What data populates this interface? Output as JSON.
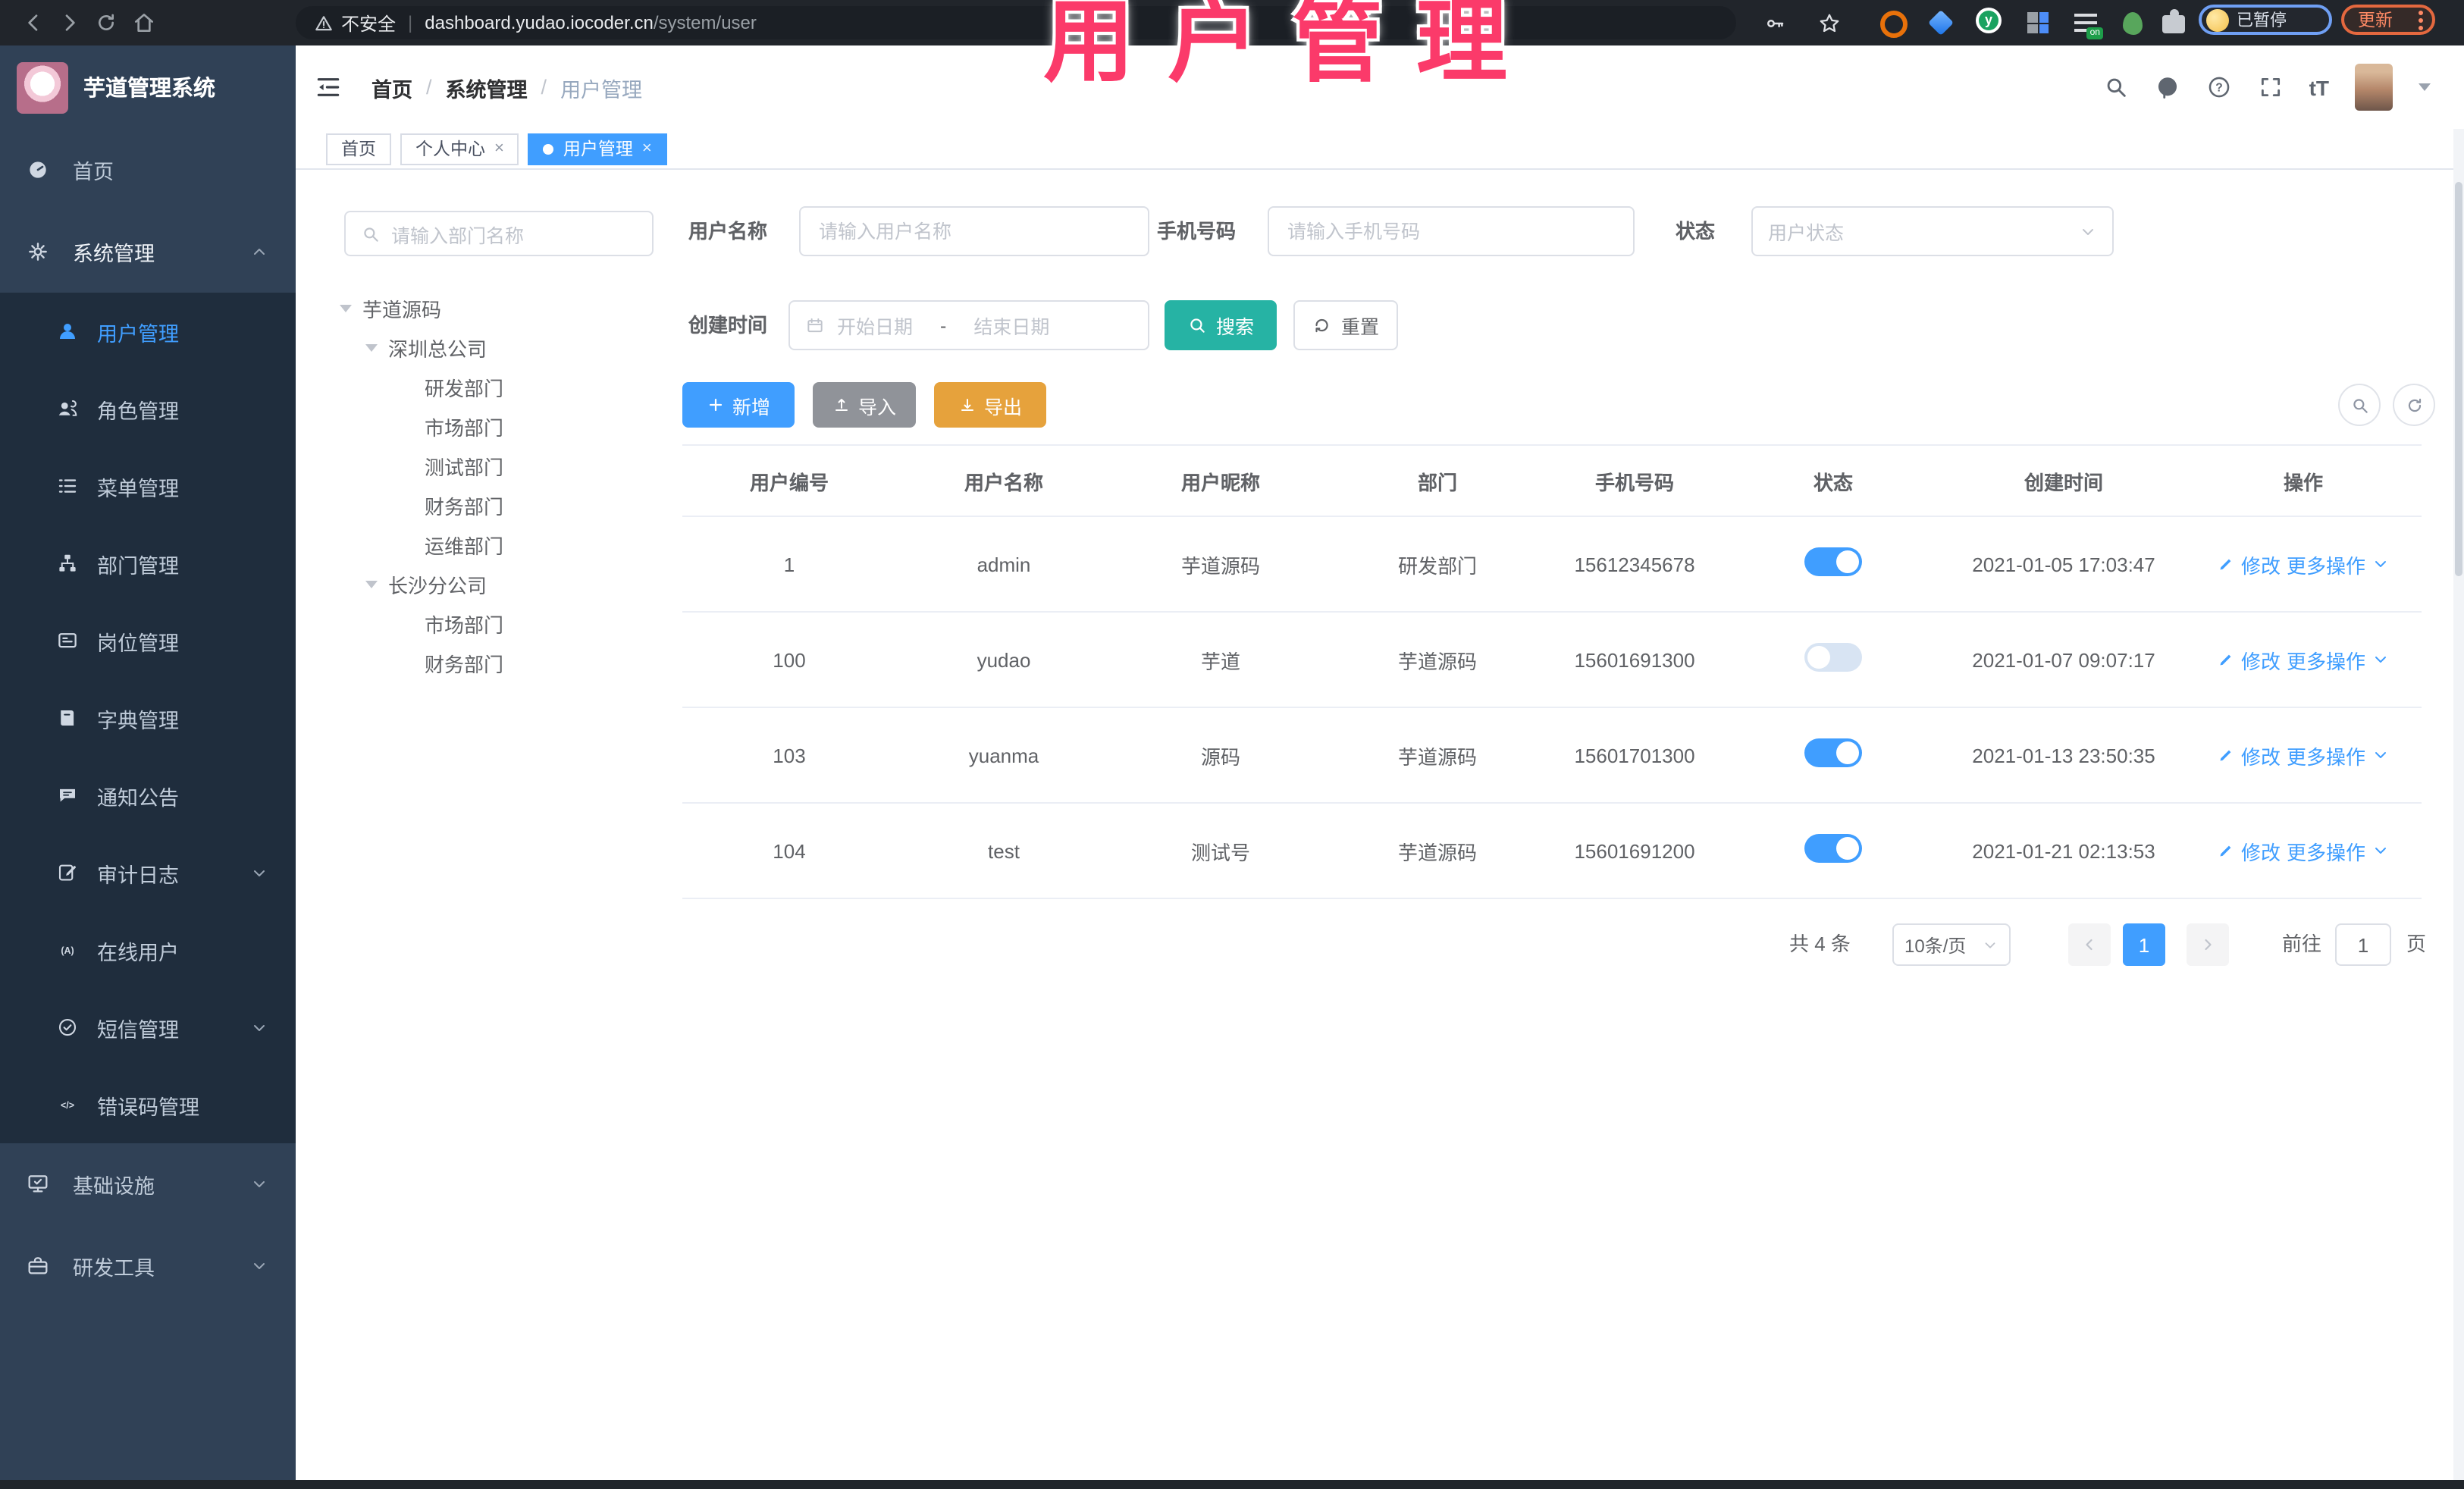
{
  "browser": {
    "security_label": "不安全",
    "url_host": "dashboard.yudao.iocoder.cn",
    "url_path": "/system/user",
    "profile_badge": "已暂停",
    "update_label": "更新"
  },
  "overlay": {
    "title": "用户管理"
  },
  "header": {
    "breadcrumb": [
      "首页",
      "系统管理",
      "用户管理"
    ],
    "font_label": "tT"
  },
  "tabs": [
    {
      "label": "首页"
    },
    {
      "label": "个人中心"
    },
    {
      "label": "用户管理"
    }
  ],
  "sidebar": {
    "title": "芋道管理系统",
    "items": [
      {
        "label": "首页"
      },
      {
        "label": "系统管理"
      },
      {
        "label": "用户管理"
      },
      {
        "label": "角色管理"
      },
      {
        "label": "菜单管理"
      },
      {
        "label": "部门管理"
      },
      {
        "label": "岗位管理"
      },
      {
        "label": "字典管理"
      },
      {
        "label": "通知公告"
      },
      {
        "label": "审计日志"
      },
      {
        "label": "在线用户"
      },
      {
        "label": "短信管理"
      },
      {
        "label": "错误码管理"
      },
      {
        "label": "基础设施"
      },
      {
        "label": "研发工具"
      }
    ]
  },
  "tree": {
    "search_placeholder": "请输入部门名称",
    "nodes": [
      {
        "label": "芋道源码"
      },
      {
        "label": "深圳总公司"
      },
      {
        "label": "研发部门"
      },
      {
        "label": "市场部门"
      },
      {
        "label": "测试部门"
      },
      {
        "label": "财务部门"
      },
      {
        "label": "运维部门"
      },
      {
        "label": "长沙分公司"
      },
      {
        "label": "市场部门"
      },
      {
        "label": "财务部门"
      }
    ]
  },
  "filters": {
    "username_label": "用户名称",
    "username_placeholder": "请输入用户名称",
    "mobile_label": "手机号码",
    "mobile_placeholder": "请输入手机号码",
    "status_label": "状态",
    "status_placeholder": "用户状态",
    "create_time_label": "创建时间",
    "start_placeholder": "开始日期",
    "range_separator": "-",
    "end_placeholder": "结束日期",
    "search_button": "搜索",
    "reset_button": "重置"
  },
  "toolbar": {
    "add_label": "新增",
    "import_label": "导入",
    "export_label": "导出"
  },
  "table": {
    "headers": [
      "用户编号",
      "用户名称",
      "用户昵称",
      "部门",
      "手机号码",
      "状态",
      "创建时间",
      "操作"
    ],
    "rows": [
      {
        "id": "1",
        "username": "admin",
        "nickname": "芋道源码",
        "dept": "研发部门",
        "mobile": "15612345678",
        "status": "on",
        "created": "2021-01-05 17:03:47"
      },
      {
        "id": "100",
        "username": "yudao",
        "nickname": "芋道",
        "dept": "芋道源码",
        "mobile": "15601691300",
        "status": "off",
        "created": "2021-01-07 09:07:17"
      },
      {
        "id": "103",
        "username": "yuanma",
        "nickname": "源码",
        "dept": "芋道源码",
        "mobile": "15601701300",
        "status": "on",
        "created": "2021-01-13 23:50:35"
      },
      {
        "id": "104",
        "username": "test",
        "nickname": "测试号",
        "dept": "芋道源码",
        "mobile": "15601691200",
        "status": "on",
        "created": "2021-01-21 02:13:53"
      }
    ],
    "actions": {
      "edit": "修改",
      "more": "更多操作"
    }
  },
  "pagination": {
    "total": "共 4 条",
    "page_size": "10条/页",
    "current_page": "1",
    "goto_label": "前往",
    "goto_value": "1",
    "page_unit": "页"
  },
  "colors": {
    "primary": "#409eff",
    "search_teal": "#26b3a4",
    "warning": "#e6a23c",
    "info_gray": "#909399",
    "overlay_pink": "#fb3a6a",
    "sidebar_bg": "#304156",
    "submenu_bg": "#1f2d3d"
  }
}
